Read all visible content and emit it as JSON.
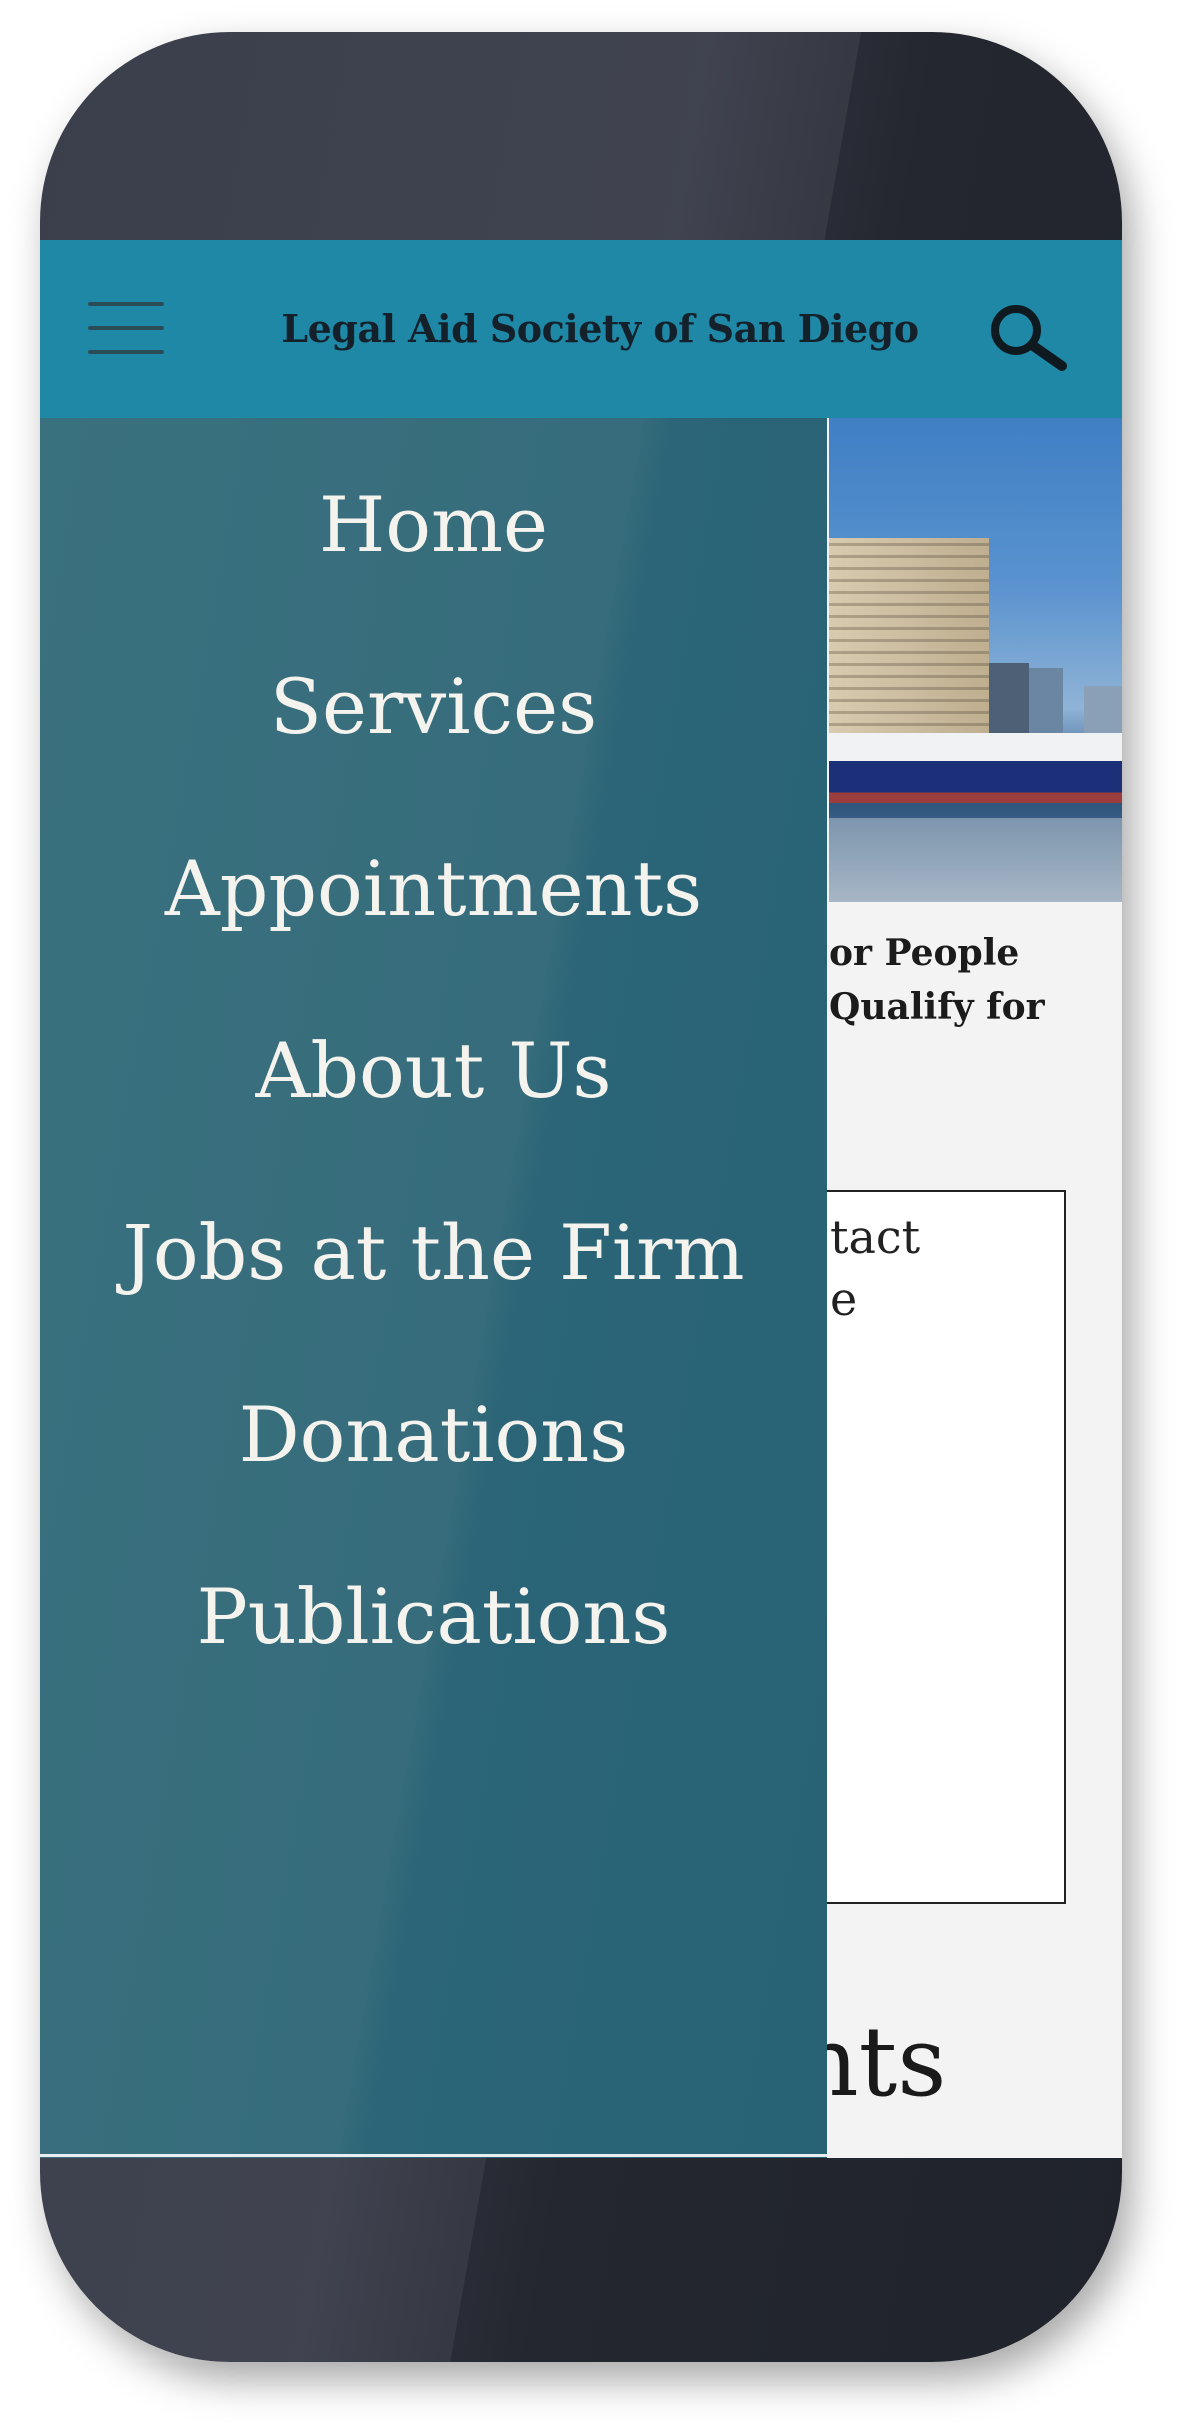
{
  "header": {
    "title": "Legal Aid Society of San Diego",
    "menu_icon": "hamburger-menu-icon",
    "search_icon": "search-icon"
  },
  "drawer": {
    "items": [
      {
        "label": "Home"
      },
      {
        "label": "Services"
      },
      {
        "label": "Appointments"
      },
      {
        "label": "About Us"
      },
      {
        "label": "Jobs at the Firm"
      },
      {
        "label": "Donations"
      },
      {
        "label": "Publications"
      }
    ]
  },
  "content": {
    "blurb_line1": "or People",
    "blurb_line2": "Qualify for",
    "box_text": "tact",
    "box_fragment": "e",
    "big_word": "ents"
  },
  "colors": {
    "header_bg": "#1e88a6",
    "drawer_bg": "#366c7b",
    "menu_text": "#f5f3ee",
    "phone_frame": "#2f3340"
  }
}
